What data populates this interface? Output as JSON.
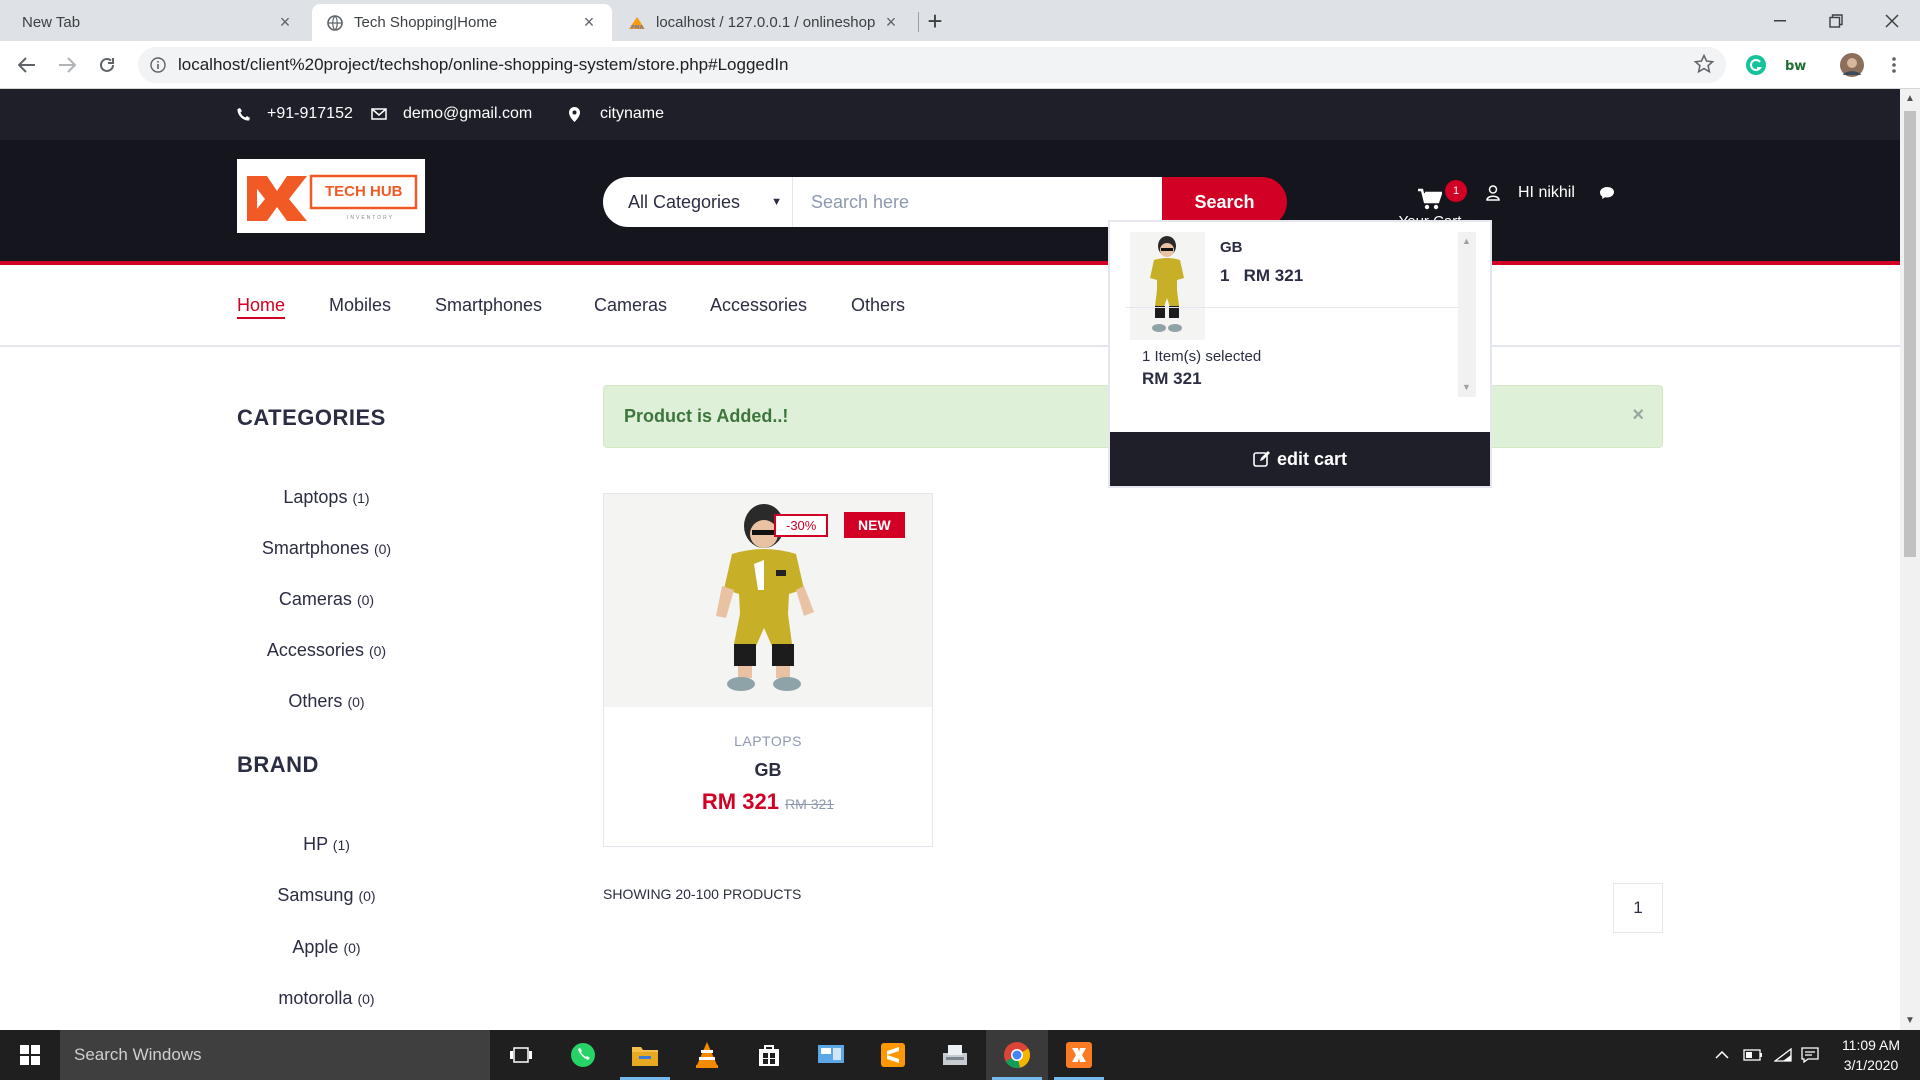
{
  "browser": {
    "tabs": [
      {
        "title": "New Tab"
      },
      {
        "title": "Tech Shopping|Home"
      },
      {
        "title": "localhost / 127.0.0.1 / onlineshop"
      }
    ],
    "url": "localhost/client%20project/techshop/online-shopping-system/store.php#LoggedIn"
  },
  "top_header": {
    "phone": "+91-917152",
    "email": "demo@gmail.com",
    "city": "cityname"
  },
  "header": {
    "logo_text": "TECH HUB",
    "logo_sub": "INVENTORY",
    "category_select": "All Categories",
    "search_placeholder": "Search here",
    "search_button": "Search",
    "cart_label": "Your Cart",
    "cart_qty": "1",
    "greeting": "HI nikhil"
  },
  "nav": [
    "Home",
    "Mobiles",
    "Smartphones",
    "Cameras",
    "Accessories",
    "Others"
  ],
  "aside": {
    "categories_title": "CATEGORIES",
    "categories": [
      {
        "name": "Laptops",
        "count": "(1)"
      },
      {
        "name": "Smartphones",
        "count": "(0)"
      },
      {
        "name": "Cameras",
        "count": "(0)"
      },
      {
        "name": "Accessories",
        "count": "(0)"
      },
      {
        "name": "Others",
        "count": "(0)"
      }
    ],
    "brand_title": "BRAND",
    "brands": [
      {
        "name": "HP",
        "count": "(1)"
      },
      {
        "name": "Samsung",
        "count": "(0)"
      },
      {
        "name": "Apple",
        "count": "(0)"
      },
      {
        "name": "motorolla",
        "count": "(0)"
      }
    ]
  },
  "alert": {
    "message": "Product is Added..!",
    "close": "×"
  },
  "product": {
    "sale_label": "-30%",
    "new_label": "NEW",
    "category": "LAPTOPS",
    "name": "GB",
    "price": "RM 321",
    "old_price": "RM 321"
  },
  "store_footer": {
    "showing": "SHOWING 20-100 PRODUCTS",
    "page": "1"
  },
  "cart_dropdown": {
    "item_name": "GB",
    "item_qty": "1",
    "item_price": "RM 321",
    "summary": "1 Item(s) selected",
    "subtotal": "RM 321",
    "edit_button": "edit cart"
  },
  "taskbar": {
    "search_placeholder": "Search Windows",
    "time": "11:09 AM",
    "date": "3/1/2020"
  },
  "colors": {
    "accent": "#d10024",
    "header_dark": "#15161d",
    "top_header": "#1e1f29",
    "alert_bg": "#dff0d8",
    "alert_text": "#3c763d"
  }
}
